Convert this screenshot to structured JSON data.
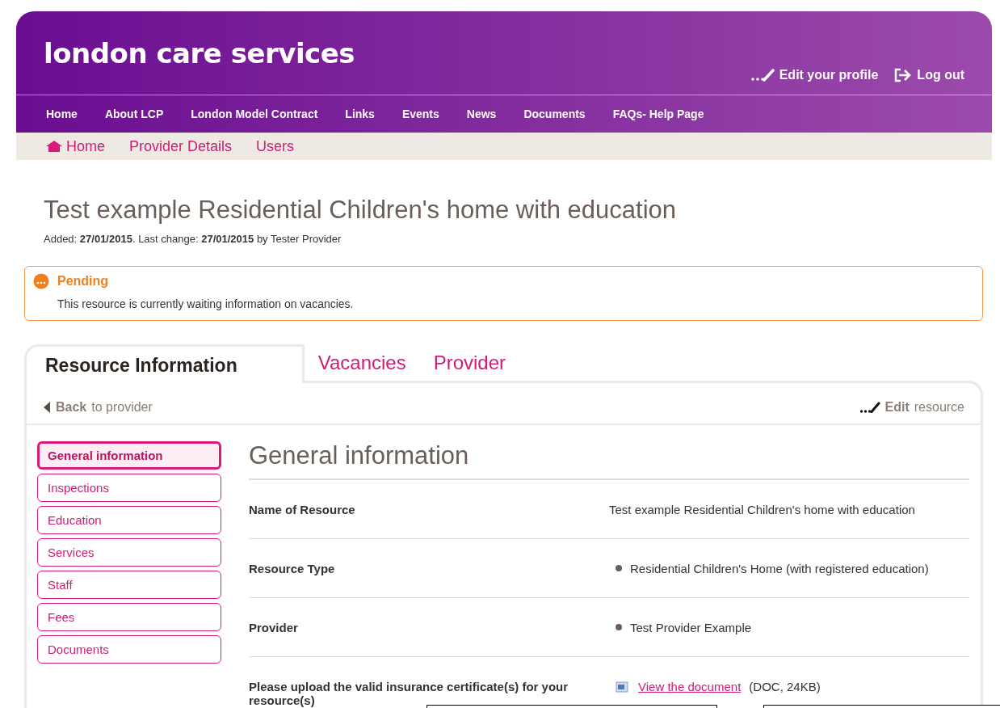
{
  "header": {
    "logo": "london care services",
    "user_links": [
      {
        "kind": "edit",
        "label": "Edit your profile"
      },
      {
        "kind": "logout",
        "label": "Log out"
      }
    ]
  },
  "nav": [
    "Home",
    "About LCP",
    "London Model Contract",
    "Links",
    "Events",
    "News",
    "Documents",
    "FAQs- Help Page"
  ],
  "subnav": [
    {
      "label": "Home",
      "kind": "home"
    },
    {
      "label": "Provider Details",
      "kind": "plain"
    },
    {
      "label": "Users",
      "kind": "plain"
    }
  ],
  "page": {
    "title": "Test example Residential Children's home with education",
    "meta": "Added: **27/01/2015**. Last change: **27/01/2015** by Tester Provider"
  },
  "status": {
    "title": "Pending",
    "message": "This resource is currently waiting information on vacancies."
  },
  "tabs": [
    {
      "label": "Resource Information",
      "selected": true
    },
    {
      "label": "Vacancies",
      "selected": false
    },
    {
      "label": "Provider",
      "selected": false
    }
  ],
  "toolbar": {
    "back": "**Back** to provider",
    "edit": "**Edit** resource"
  },
  "sections": [
    {
      "label": "General information",
      "selected": true
    },
    {
      "label": "Inspections",
      "selected": false
    },
    {
      "label": "Education",
      "selected": false
    },
    {
      "label": "Services",
      "selected": false
    },
    {
      "label": "Staff",
      "selected": false
    },
    {
      "label": "Fees",
      "selected": false
    },
    {
      "label": "Documents",
      "selected": false
    }
  ],
  "content": {
    "heading": "General information",
    "rows": [
      {
        "label": "Name of Resource",
        "kind": "text",
        "value": "Test example Residential Children's home with education"
      },
      {
        "label": "Resource Type",
        "kind": "bullet",
        "value": "Residential Children's Home (with registered education)"
      },
      {
        "label": "Provider",
        "kind": "bullet",
        "value": "Test Provider Example"
      },
      {
        "label": "Please upload the valid insurance certificate(s) for your resource(s)",
        "kind": "document",
        "value": "View the document",
        "detail": "(DOC, 24KB)"
      }
    ]
  }
}
